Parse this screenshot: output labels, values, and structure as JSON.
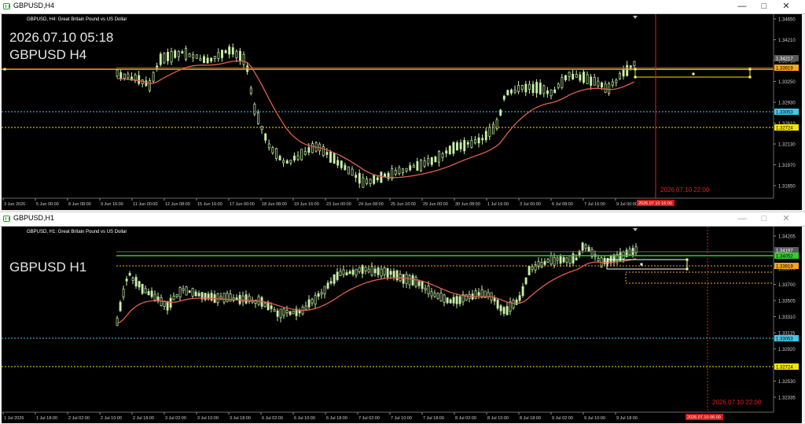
{
  "windows": [
    {
      "title": "GBPUSD,H4",
      "header": "GBPUSD, H4:  Great Britain Pound vs US Dollar",
      "overlay_line1": "2026.07.10 05:18",
      "overlay_line2": "GBPUSD H4",
      "price_labels": [
        "1.34650",
        "1.34210",
        "1.33750",
        "1.33250",
        "1.32930",
        "1.32610",
        "1.32130",
        "1.31970",
        "1.31650"
      ],
      "price_badges": [
        {
          "text": "1.34217",
          "bg": "#5a5a5a",
          "fg": "#ffffff"
        },
        {
          "text": "1.33919",
          "bg": "#f5a623",
          "fg": "#000000"
        },
        {
          "text": "1.33053",
          "bg": "#45c6e8",
          "fg": "#000000"
        },
        {
          "text": "1.32724",
          "bg": "#f2e600",
          "fg": "#000000"
        }
      ],
      "time_labels": [
        "3 Jun 2026",
        "5 Jun 00:00",
        "8 Jun 08:00",
        "9 Jun 16:00",
        "11 Jun 00:00",
        "12 Jun 08:00",
        "15 Jun 16:00",
        "17 Jun 00:00",
        "18 Jun 08:00",
        "19 Jun 16:00",
        "23 Jun 00:00",
        "24 Jun 08:00",
        "25 Jun 16:00",
        "29 Jun 00:00",
        "30 Jun 08:00",
        "1 Jul 16:00",
        "3 Jul 00:00",
        "6 Jul 08:00",
        "7 Jul 16:00",
        "9 Jul 00:00"
      ],
      "time_badge": "2026.07.10 16:00",
      "vline_label": "2026.07.10 22:00"
    },
    {
      "title": "GBPUSD,H1",
      "header": "GBPUSD, H1:  Great Britain Pound vs US Dollar",
      "overlay_line2": "GBPUSD H1",
      "price_labels": [
        "1.34205",
        "1.34025",
        "1.33870",
        "1.33700",
        "1.33505",
        "1.33310",
        "1.33115",
        "1.32920",
        "1.32725",
        "1.32530",
        "1.32335"
      ],
      "price_badges": [
        {
          "text": "1.34197",
          "bg": "#5a5a5a",
          "fg": "#ffffff"
        },
        {
          "text": "1.34052",
          "bg": "#33cc33",
          "fg": "#000000"
        },
        {
          "text": "1.33919",
          "bg": "#f5a623",
          "fg": "#000000"
        },
        {
          "text": "1.33053",
          "bg": "#45c6e8",
          "fg": "#000000"
        },
        {
          "text": "1.32724",
          "bg": "#f2e600",
          "fg": "#000000"
        }
      ],
      "time_labels": [
        "1 Jul 2026",
        "1 Jul 18:00",
        "2 Jul 02:00",
        "2 Jul 10:00",
        "2 Jul 18:00",
        "3 Jul 02:00",
        "3 Jul 10:00",
        "3 Jul 18:00",
        "6 Jul 02:00",
        "6 Jul 10:00",
        "6 Jul 18:00",
        "7 Jul 02:00",
        "7 Jul 10:00",
        "7 Jul 18:00",
        "8 Jul 02:00",
        "8 Jul 10:00",
        "8 Jul 18:00",
        "9 Jul 02:00",
        "9 Jul 10:00",
        "9 Jul 18:00"
      ],
      "time_badge": "2026.07.10 06:00",
      "vline_label": "2026.07.10 22:00"
    }
  ],
  "colors": {
    "bull": "#c8f0a8",
    "bear": "#c8f0a8",
    "ma": "#e0604a",
    "vline": "#e02020",
    "level_orange": "#f5a623",
    "level_cyan": "#45c6e8",
    "level_yellow": "#f2e600",
    "level_green": "#33cc33"
  },
  "icons": [
    "chart-window-icon",
    "minimize-icon",
    "maximize-icon",
    "close-icon"
  ]
}
